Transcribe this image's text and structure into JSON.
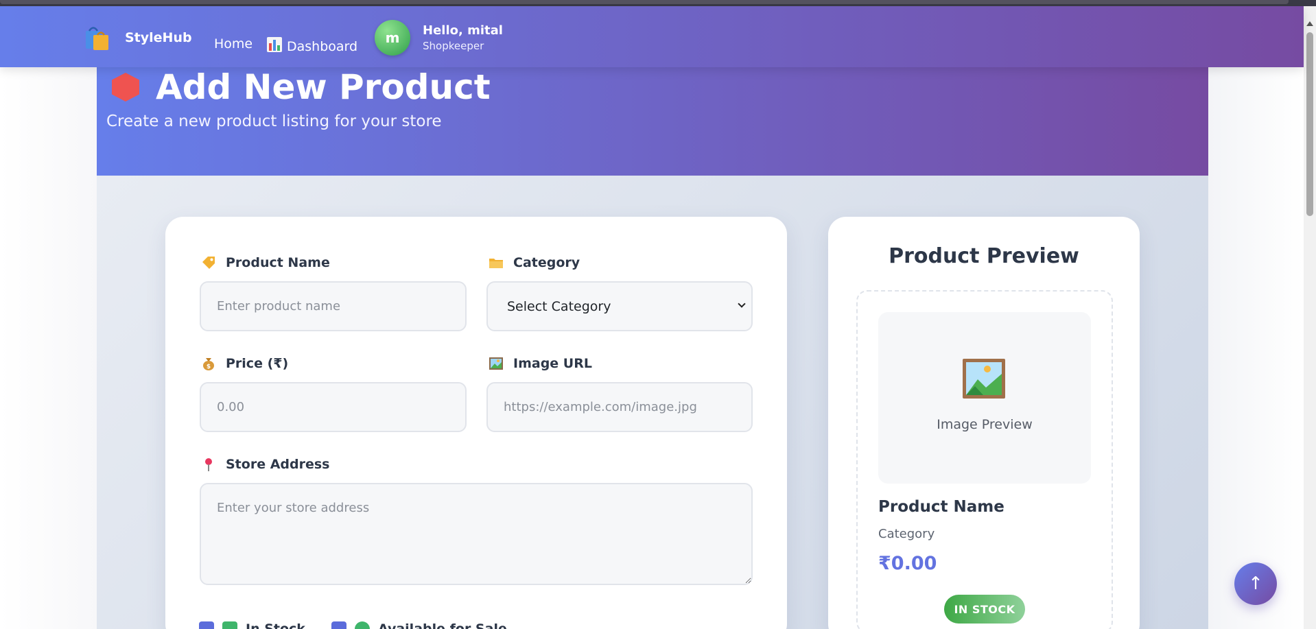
{
  "navbar": {
    "brand": "StyleHub",
    "home": "Home",
    "dashboard": "Dashboard",
    "user_greeting": "Hello, mital",
    "user_role": "Shopkeeper",
    "avatar_letter": "m"
  },
  "hero": {
    "title": "Add New Product",
    "subtitle": "Create a new product listing for your store"
  },
  "form": {
    "product_name_label": "Product Name",
    "product_name_placeholder": "Enter product name",
    "category_label": "Category",
    "category_selected": "Select Category",
    "price_label": "Price (₹)",
    "price_placeholder": "0.00",
    "image_url_label": "Image URL",
    "image_url_placeholder": "https://example.com/image.jpg",
    "store_address_label": "Store Address",
    "store_address_placeholder": "Enter your store address",
    "in_stock_label": "In Stock",
    "available_label": "Available for Sale"
  },
  "preview": {
    "title": "Product Preview",
    "image_label": "Image Preview",
    "name": "Product Name",
    "category": "Category",
    "price": "₹0.00",
    "badge": "IN STOCK"
  },
  "back_to_top": "↑",
  "colors": {
    "accent_start": "#667eea",
    "accent_end": "#764ba2",
    "in_stock_green": "#3ea845",
    "price_color": "#6373e0"
  }
}
